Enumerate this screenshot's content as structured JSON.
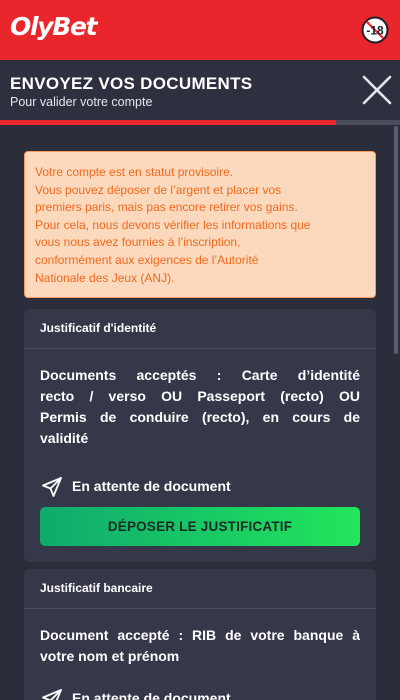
{
  "app": {
    "logo_text": "OlyBet",
    "age_badge": "-18",
    "brand_color": "#e8262b"
  },
  "modal": {
    "title": "ENVOYEZ VOS DOCUMENTS",
    "subtitle": "Pour valider votre compte",
    "close_icon": "close-icon",
    "progress_percent": 84
  },
  "warning": {
    "lines": [
      "Votre compte est en statut provisoire.",
      "Vous pouvez déposer de l’argent et placer vos",
      "premiers paris, mais pas encore retirer vos gains.",
      "Pour cela, nous devons vérifier les informations que",
      "vous nous avez fournies à l’inscription,",
      "conformément aux exigences de l’Autorité",
      "Nationale des Jeux (ANJ)."
    ],
    "text_color": "#ef6a1f",
    "background_color": "#fcd9bd"
  },
  "cards": [
    {
      "title": "Justificatif d'identité",
      "description_lines": [
        "Documents acceptés : Carte d’identité",
        "recto / verso OU Passeport (recto) OU",
        "Permis de conduire (recto), en cours de",
        "validité"
      ],
      "status_icon": "send-icon",
      "status": "En attente de document",
      "button_label": "DÉPOSER LE JUSTIFICATIF"
    },
    {
      "title": "Justificatif bancaire",
      "description_lines": [
        "Document accepté : RIB de votre banque à",
        "votre nom et prénom"
      ],
      "status_icon": "send-icon",
      "status": "En attente de document"
    }
  ],
  "button_gradient": [
    "#0faa6e",
    "#22e65b"
  ]
}
